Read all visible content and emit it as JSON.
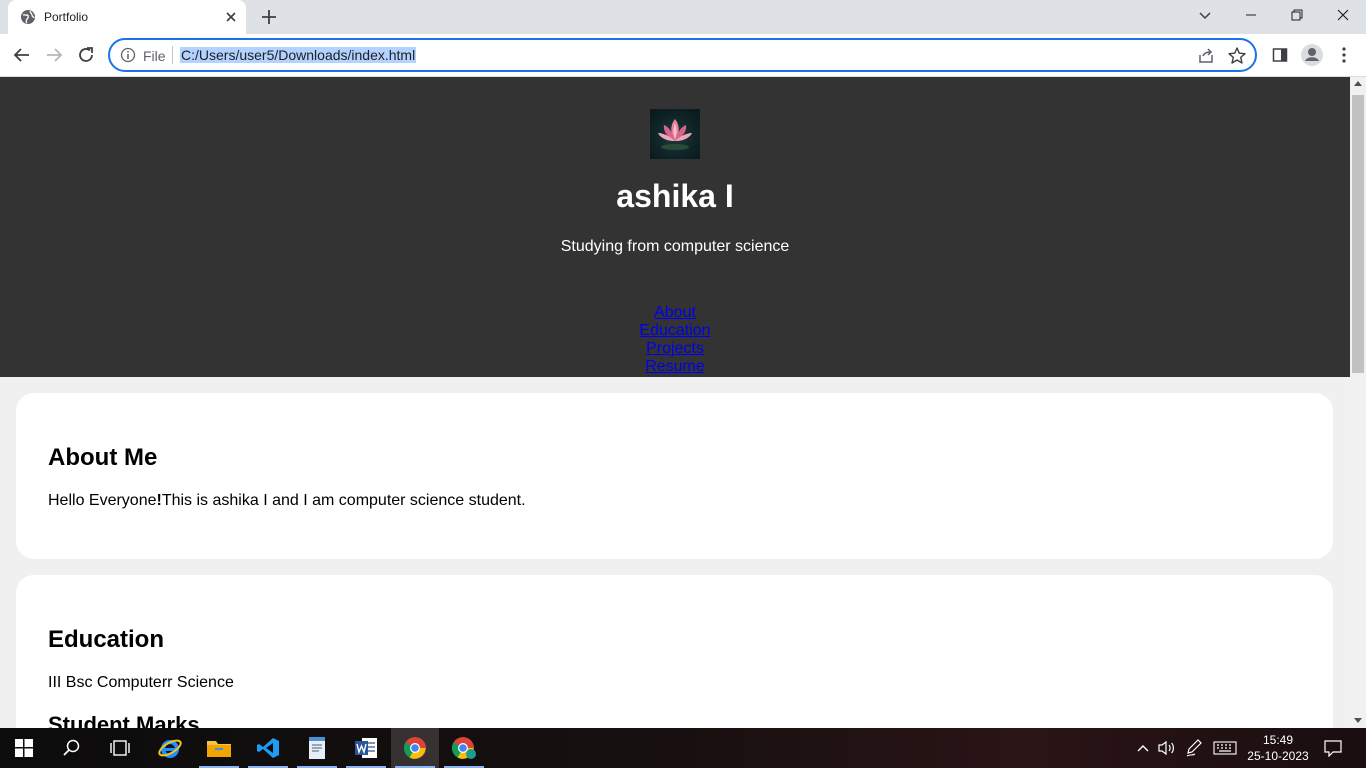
{
  "browser": {
    "tab_title": "Portfolio",
    "omnibox_scheme": "File",
    "url": "C:/Users/user5/Downloads/index.html"
  },
  "site": {
    "name": "ashika I",
    "tagline": "Studying from computer science",
    "nav": [
      "About",
      "Education",
      "Projects",
      "Resume"
    ]
  },
  "about": {
    "heading": "About Me",
    "text_prefix": "Hello Everyone",
    "text_bang": "!",
    "text_suffix": "This is ashika I and I am computer science student."
  },
  "education": {
    "heading": "Education",
    "degree": "III Bsc Computerr Science",
    "subheading": "Student Marks"
  },
  "taskbar": {
    "time": "15:49",
    "date": "25-10-2023"
  },
  "colors": {
    "header_bg": "#333333",
    "link": "#0000ee",
    "omnibox_focus": "#1a73e8",
    "url_selection": "#b3d2ff"
  }
}
